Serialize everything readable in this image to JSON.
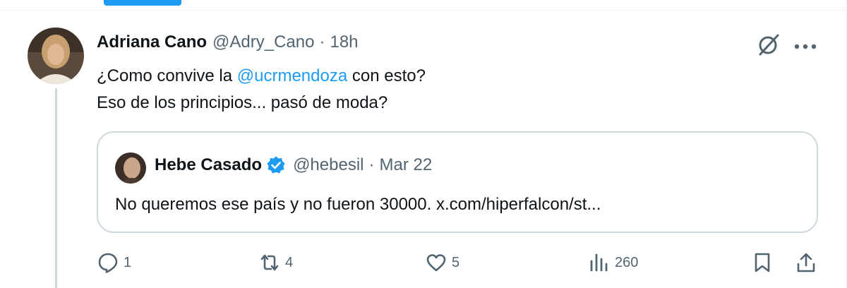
{
  "tweet": {
    "author_name": "Adriana Cano",
    "handle": "@Adry_Cano",
    "separator": "·",
    "time": "18h",
    "text_line1_pre": "¿Como convive la ",
    "mention": "@ucrmendoza",
    "text_line1_post": " con esto?",
    "text_line2": "Eso de los principios... pasó de moda?"
  },
  "quote": {
    "author_name": "Hebe Casado",
    "handle": "@hebesil",
    "separator": "·",
    "date": "Mar 22",
    "text": "No queremos ese país y no fueron 30000. x.com/hiperfalcon/st..."
  },
  "actions": {
    "replies": "1",
    "reposts": "4",
    "likes": "5",
    "views": "260"
  },
  "icons": [
    "reply-icon",
    "repost-icon",
    "like-icon",
    "views-icon",
    "bookmark-icon",
    "share-icon",
    "grok-icon",
    "more-icon",
    "verified-icon"
  ],
  "colors": {
    "accent": "#1d9bf0",
    "text_primary": "#0f1419",
    "text_secondary": "#536471",
    "border": "#cfd9de",
    "tab_indicator": "#1d9bf0"
  }
}
